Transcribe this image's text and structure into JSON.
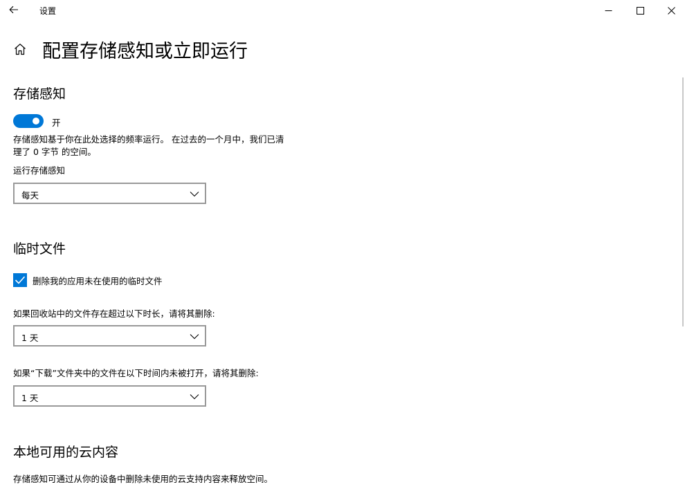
{
  "window": {
    "title": "设置",
    "icons": {
      "back": "back-arrow-icon",
      "minimize": "minimize-icon",
      "maximize": "maximize-icon",
      "close": "close-icon"
    }
  },
  "header": {
    "home_icon": "home-icon",
    "title": "配置存储感知或立即运行"
  },
  "storage_sense": {
    "heading": "存储感知",
    "toggle_state": "on",
    "toggle_label": "开",
    "description_line1": "存储感知基于你在此处选择的频率运行。 在过去的一个月中，我们已清",
    "description_line2": "理了 0 字节 的空间。",
    "run_label": "运行存储感知",
    "run_value": "每天"
  },
  "temp_files": {
    "heading": "临时文件",
    "delete_temp_label": "删除我的应用未在使用的临时文件",
    "delete_temp_checked": true,
    "recycle_bin_label": "如果回收站中的文件存在超过以下时长，请将其删除:",
    "recycle_bin_value": "1 天",
    "downloads_label": "如果“下载”文件夹中的文件在以下时间内未被打开，请将其删除:",
    "downloads_value": "1 天"
  },
  "cloud_content": {
    "heading": "本地可用的云内容",
    "description": "存储感知可通过从你的设备中删除未使用的云支持内容来释放空间。"
  },
  "colors": {
    "accent": "#0078d7",
    "dropdown_border": "#999999",
    "background": "#ffffff"
  }
}
